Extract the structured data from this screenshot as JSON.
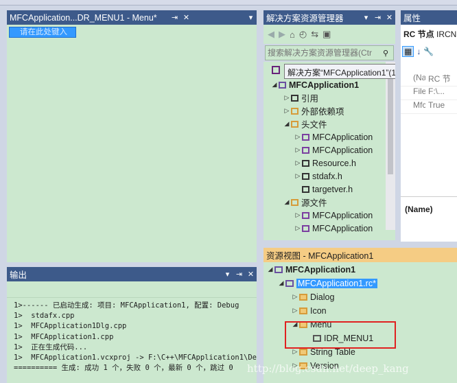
{
  "menu_editor": {
    "tab_title": "MFCApplication...DR_MENU1 - Menu*",
    "pin": "⇥",
    "close": "✕",
    "type_here": "请在此处键入"
  },
  "output": {
    "title": "输出",
    "dropdown": "▾",
    "pin": "⇥",
    "close": "✕",
    "lines": [
      "1>------ 已启动生成: 项目: MFCApplication1, 配置: Debug",
      "1>  stdafx.cpp",
      "1>  MFCApplication1Dlg.cpp",
      "1>  MFCApplication1.cpp",
      "1>  正在生成代码...",
      "1>  MFCApplication1.vcxproj -> F:\\C++\\MFCApplication1\\De",
      "========== 生成: 成功 1 个，失败 0 个，最新 0 个，跳过 0"
    ]
  },
  "solution_explorer": {
    "title": "解决方案资源管理器",
    "dropdown": "▾",
    "pin": "⇥",
    "close": "✕",
    "search_placeholder": "搜索解决方案资源管理器(Ctr",
    "tooltip": "解决方案“MFCApplication1”(1 个项目)",
    "items": [
      {
        "label": "MFCApplication1",
        "bold": true
      },
      {
        "label": "引用"
      },
      {
        "label": "外部依赖项"
      },
      {
        "label": "头文件"
      },
      {
        "label": "MFCApplication"
      },
      {
        "label": "MFCApplication"
      },
      {
        "label": "Resource.h"
      },
      {
        "label": "stdafx.h"
      },
      {
        "label": "targetver.h"
      },
      {
        "label": "源文件"
      },
      {
        "label": "MFCApplication"
      },
      {
        "label": "MFCApplication"
      }
    ]
  },
  "properties": {
    "title": "属性",
    "object_label": "RC 节点",
    "object_value": "IRCN",
    "rows": [
      {
        "name": "(Nam",
        "value": "RC 节"
      },
      {
        "name": "Filena",
        "value": "F:\\..."
      },
      {
        "name": "Mfc M",
        "value": "True"
      }
    ],
    "desc_name": "(Name)"
  },
  "resource_view": {
    "title": "资源视图 - MFCApplication1",
    "items": [
      {
        "label": "MFCApplication1",
        "bold": true
      },
      {
        "label": "MFCApplication1.rc*"
      },
      {
        "label": "Dialog"
      },
      {
        "label": "Icon"
      },
      {
        "label": "Menu"
      },
      {
        "label": "IDR_MENU1"
      },
      {
        "label": "String Table"
      },
      {
        "label": "Version"
      }
    ]
  },
  "watermark": "http://blog.csdn.net/deep_kang",
  "colors": {
    "panel_title": "#3d5a8a",
    "menu_bg": "#cce8cf",
    "highlight": "#3399ff",
    "red_box": "#e02020"
  }
}
